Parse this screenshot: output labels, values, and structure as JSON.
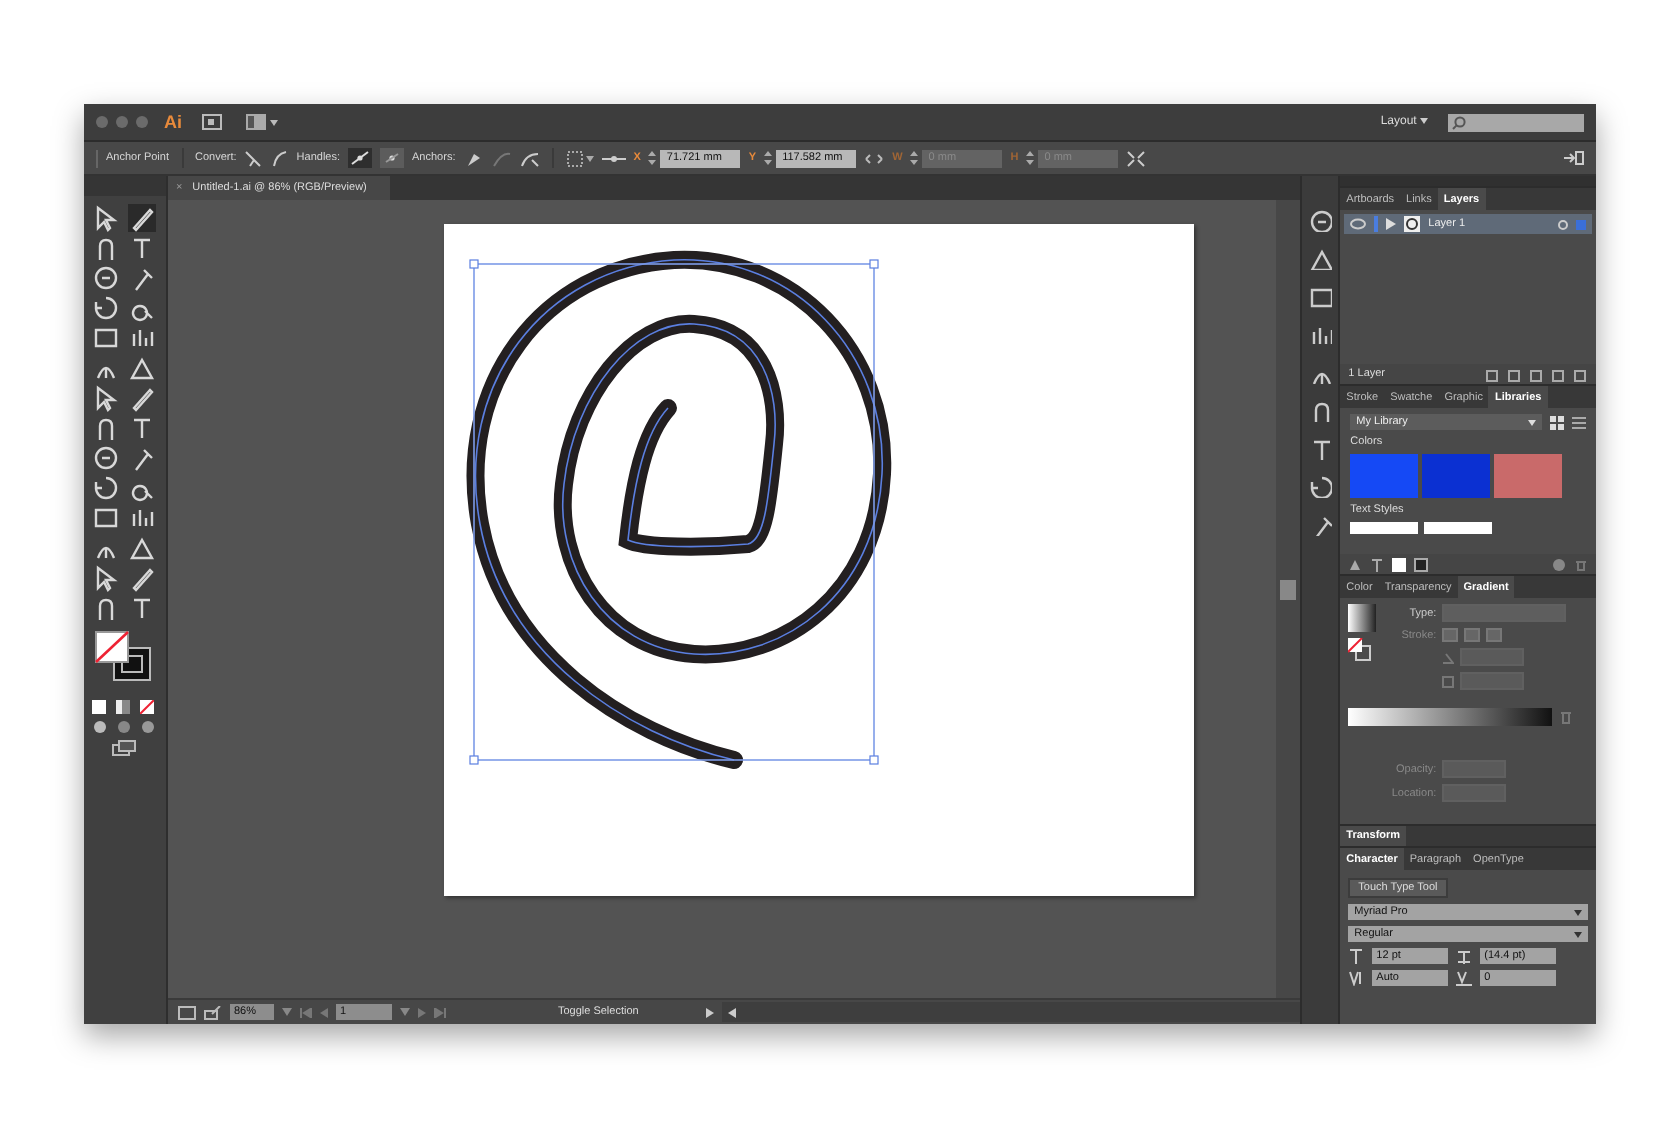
{
  "title_bar": {
    "logo": "Ai",
    "workspace": "Layout"
  },
  "control_bar": {
    "tool": "Anchor Point",
    "convert_label": "Convert:",
    "handles_label": "Handles:",
    "anchors_label": "Anchors:",
    "fields": [
      {
        "label": "X",
        "value": "71.721 mm",
        "disabled": false
      },
      {
        "label": "Y",
        "value": "117.582 mm",
        "disabled": false
      },
      {
        "label": "W",
        "value": "0 mm",
        "disabled": true
      },
      {
        "label": "H",
        "value": "0 mm",
        "disabled": true
      }
    ]
  },
  "document_tab": {
    "close": "×",
    "title": "Untitled-1.ai @ 86% (RGB/Preview)"
  },
  "layers_panel": {
    "tabs": [
      {
        "label": "Artboards",
        "selected": false
      },
      {
        "label": "Links",
        "selected": false
      },
      {
        "label": "Layers",
        "selected": true
      }
    ],
    "layers": [
      {
        "name": "Layer 1",
        "selected": true
      }
    ],
    "footer": "1 Layer"
  },
  "libraries_panel": {
    "tabs": [
      {
        "label": "Stroke",
        "selected": false
      },
      {
        "label": "Swatche",
        "selected": false
      },
      {
        "label": "Graphic",
        "selected": false
      },
      {
        "label": "Libraries",
        "selected": true
      }
    ],
    "library": "My Library",
    "colors_heading": "Colors",
    "swatches": [
      {
        "color": "#1549f5"
      },
      {
        "color": "#0b30d2"
      },
      {
        "color": "#c96a6a"
      }
    ],
    "text_styles_heading": "Text Styles"
  },
  "gradient_panel": {
    "tabs": [
      {
        "label": "Color",
        "selected": false
      },
      {
        "label": "Transparency",
        "selected": false
      },
      {
        "label": "Gradient",
        "selected": true
      }
    ],
    "type_label": "Type:",
    "stroke_label": "Stroke:",
    "opacity_label": "Opacity:",
    "location_label": "Location:"
  },
  "transform_panel": {
    "title": "Transform"
  },
  "character_panel": {
    "tabs": [
      {
        "label": "Character",
        "selected": true
      },
      {
        "label": "Paragraph",
        "selected": false
      },
      {
        "label": "OpenType",
        "selected": false
      }
    ],
    "touch_type_button": "Touch Type Tool",
    "font": "Myriad Pro",
    "style": "Regular",
    "size": "12 pt",
    "leading": "(14.4 pt)",
    "kerning": "Auto",
    "tracking": "0"
  },
  "status_bar": {
    "zoom": "86%",
    "artboard": "1",
    "status": "Toggle Selection"
  }
}
